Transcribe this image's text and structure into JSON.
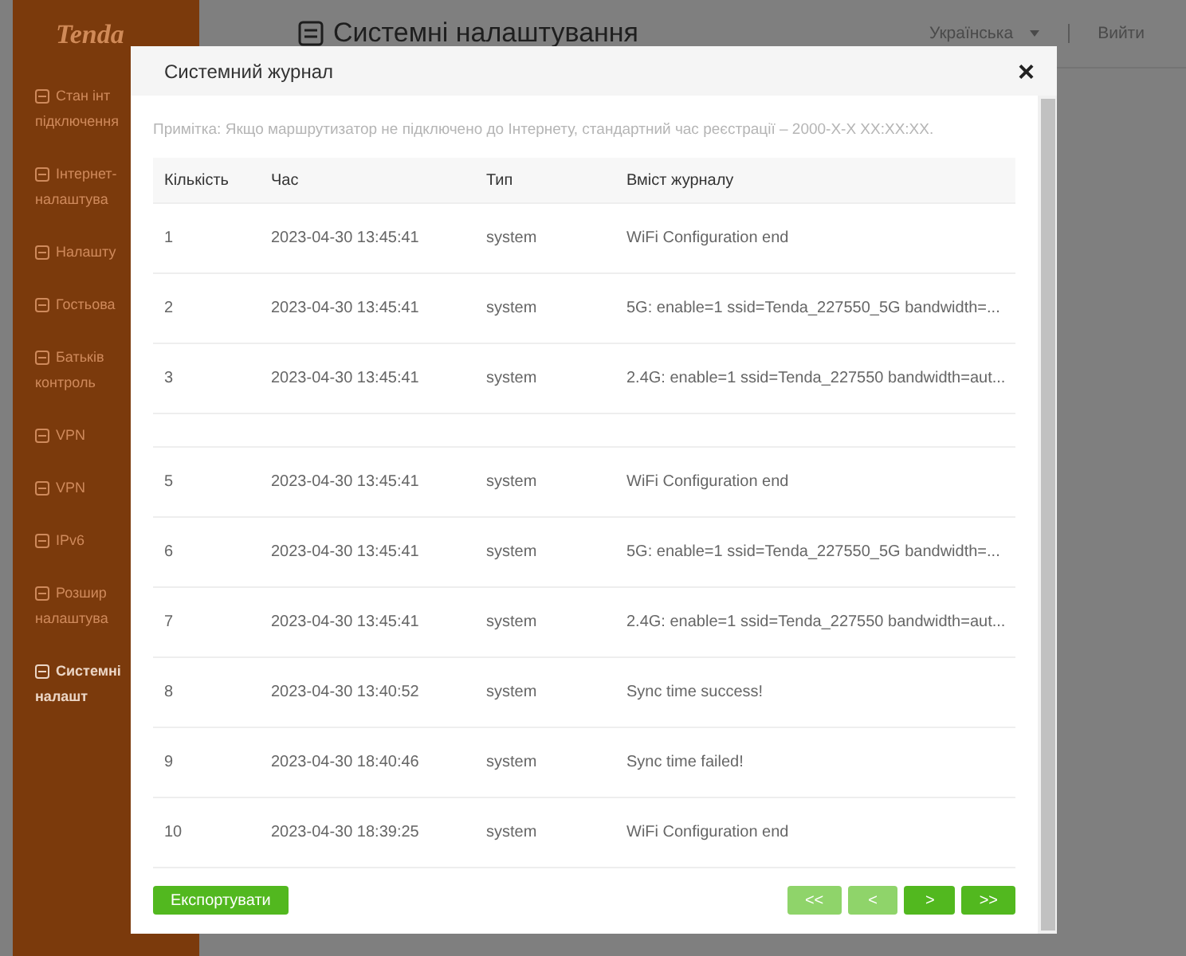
{
  "sidebar": {
    "logo": "Tenda",
    "items": [
      {
        "lines": [
          "Стан інт",
          "підключення"
        ],
        "selected": false
      },
      {
        "lines": [
          "Інтернет-",
          "налаштува"
        ],
        "selected": false
      },
      {
        "lines": [
          "Налашту"
        ],
        "selected": false
      },
      {
        "lines": [
          "Гостьова"
        ],
        "selected": false
      },
      {
        "lines": [
          "Батьків",
          "контроль"
        ],
        "selected": false
      },
      {
        "lines": [
          "VPN"
        ],
        "selected": false
      },
      {
        "lines": [
          "VPN"
        ],
        "selected": false
      },
      {
        "lines": [
          "IPv6"
        ],
        "selected": false
      },
      {
        "lines": [
          "Розшир",
          "налаштува"
        ],
        "selected": false
      },
      {
        "lines": [
          "Системні",
          "налашт"
        ],
        "selected": true
      }
    ]
  },
  "header": {
    "title": "Системні налаштування",
    "language": "Українська",
    "logout": "Вийти"
  },
  "modal": {
    "title": "Системний журнал",
    "close": "×",
    "note": "Примітка: Якщо маршрутизатор не підключено до Інтернету, стандартний час реєстрації – 2000-X-X XX:XX:XX.",
    "columns": [
      "Кількість",
      "Час",
      "Тип",
      "Вміст журналу"
    ],
    "rows": [
      {
        "kind": "entry",
        "cells": [
          "1",
          "2023-04-30 13:45:41",
          "system",
          "WiFi Configuration end"
        ]
      },
      {
        "kind": "entry",
        "cells": [
          "2",
          "2023-04-30 13:45:41",
          "system",
          "5G: enable=1 ssid=Tenda_227550_5G bandwidth=..."
        ]
      },
      {
        "kind": "entry",
        "cells": [
          "3",
          "2023-04-30 13:45:41",
          "system",
          "2.4G: enable=1 ssid=Tenda_227550 bandwidth=aut..."
        ]
      },
      {
        "kind": "blank"
      },
      {
        "kind": "entry",
        "cells": [
          "5",
          "2023-04-30 13:45:41",
          "system",
          "WiFi Configuration end"
        ]
      },
      {
        "kind": "entry",
        "cells": [
          "6",
          "2023-04-30 13:45:41",
          "system",
          "5G: enable=1 ssid=Tenda_227550_5G bandwidth=..."
        ]
      },
      {
        "kind": "entry",
        "cells": [
          "7",
          "2023-04-30 13:45:41",
          "system",
          "2.4G: enable=1 ssid=Tenda_227550 bandwidth=aut..."
        ]
      },
      {
        "kind": "entry",
        "cells": [
          "8",
          "2023-04-30 13:40:52",
          "system",
          "Sync time success!"
        ]
      },
      {
        "kind": "entry",
        "cells": [
          "9",
          "2023-04-30 18:40:46",
          "system",
          "Sync time failed!"
        ]
      },
      {
        "kind": "entry",
        "cells": [
          "10",
          "2023-04-30 18:39:25",
          "system",
          "WiFi Configuration end"
        ]
      }
    ],
    "export": "Експортувати",
    "pager": [
      {
        "label": "<<",
        "disabled": true
      },
      {
        "label": "<",
        "disabled": true
      },
      {
        "label": ">",
        "disabled": false
      },
      {
        "label": ">>",
        "disabled": false
      }
    ]
  }
}
